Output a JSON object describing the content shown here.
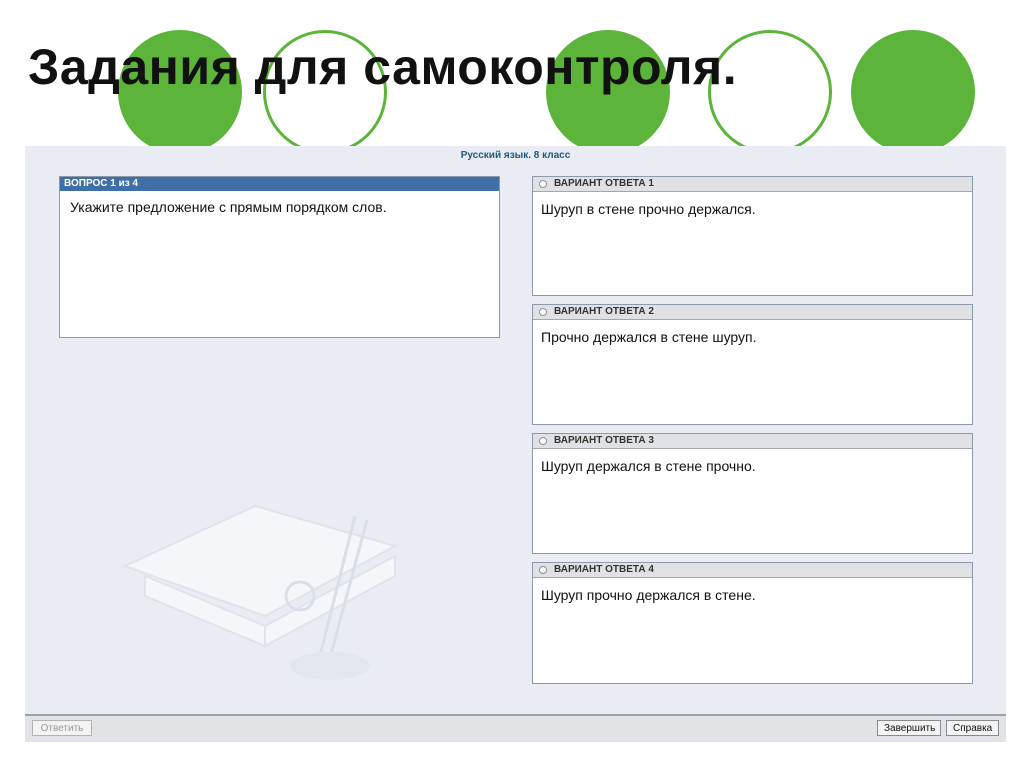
{
  "slide": {
    "title": "Задания для самоконтроля."
  },
  "app": {
    "subject": "Русский язык. 8 класс"
  },
  "question": {
    "header": "ВОПРОС 1 из 4",
    "text": "Укажите предложение с прямым порядком слов."
  },
  "answers": [
    {
      "label": "ВАРИАНТ ОТВЕТА 1",
      "text": "Шуруп в стене прочно держался."
    },
    {
      "label": "ВАРИАНТ ОТВЕТА 2",
      "text": "Прочно держался в стене шуруп."
    },
    {
      "label": "ВАРИАНТ ОТВЕТА 3",
      "text": "Шуруп держался в стене прочно."
    },
    {
      "label": "ВАРИАНТ ОТВЕТА 4",
      "text": "Шуруп прочно держался в стене."
    }
  ],
  "buttons": {
    "answer": "Ответить",
    "finish": "Завершить",
    "help": "Справка"
  },
  "colors": {
    "accent_green": "#5cb43a",
    "question_header": "#3f6fa6",
    "title_blue": "#1f5a7a"
  },
  "icons": {
    "radio": "radio-button-unselected",
    "watermark": "book-and-pen-illustration"
  }
}
